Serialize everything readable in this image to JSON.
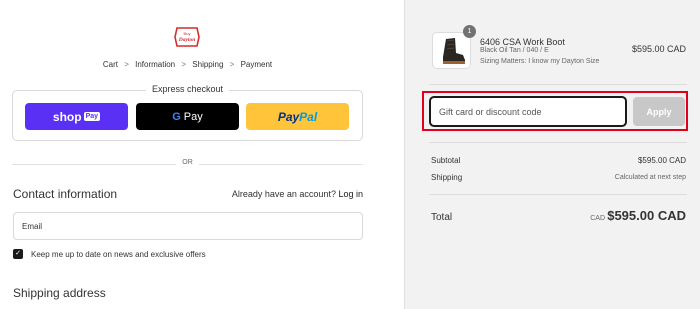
{
  "logo": {
    "text_top": "Buy",
    "text_main": "Dayton",
    "color": "#d42b2b"
  },
  "breadcrumb": {
    "items": [
      "Cart",
      "Information",
      "Shipping",
      "Payment"
    ],
    "separator": ">"
  },
  "express": {
    "title": "Express checkout",
    "shop_label": "shop",
    "shop_badge": "Pay",
    "gpay_g": "G",
    "gpay_label": "Pay",
    "paypal_pay": "Pay",
    "paypal_pal": "Pal"
  },
  "or_text": "OR",
  "contact": {
    "title": "Contact information",
    "account_text": "Already have an account?",
    "login_link": "Log in",
    "email_placeholder": "Email",
    "marketing_checkbox_label": "Keep me up to date on news and exclusive offers",
    "marketing_checked": true
  },
  "shipping": {
    "title": "Shipping address"
  },
  "summary": {
    "product": {
      "name": "6406 CSA Work Boot",
      "variant": "Black Oil Tan / 040 / E",
      "size_note": "Sizing Matters: I know my Dayton Size",
      "quantity": "1",
      "price": "$595.00 CAD"
    },
    "discount_placeholder": "Gift card or discount code",
    "apply_label": "Apply",
    "subtotal_label": "Subtotal",
    "subtotal_value": "$595.00 CAD",
    "shipping_label": "Shipping",
    "shipping_value": "Calculated at next step",
    "total_label": "Total",
    "total_currency": "CAD",
    "total_value": "$595.00 CAD"
  },
  "colors": {
    "shop_pay": "#5a31f4",
    "gpay": "#000000",
    "paypal": "#ffc439",
    "highlight": "#e0001b",
    "apply_disabled": "#c8c8c8"
  }
}
